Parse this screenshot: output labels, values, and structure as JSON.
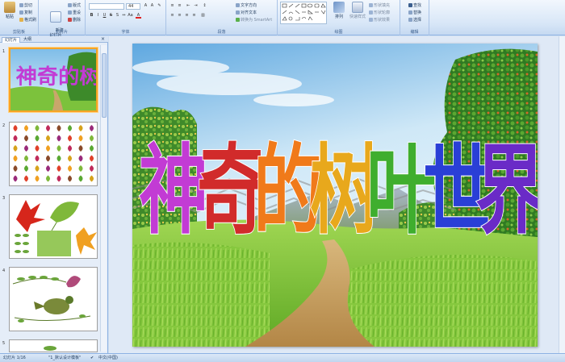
{
  "ribbon": {
    "clipboard": {
      "label": "剪贴板",
      "paste": "粘贴",
      "cut": "剪切",
      "copy": "复制",
      "format_painter": "格式刷"
    },
    "slides": {
      "label": "幻灯片",
      "new_slide": "新建\n幻灯片",
      "layout": "版式",
      "reset": "重设",
      "delete": "删除"
    },
    "font": {
      "label": "字体",
      "font_name": "",
      "font_size": "44"
    },
    "paragraph": {
      "label": "段落",
      "text_direction": "文字方向",
      "align_text": "对齐文本",
      "smartart": "转换为 SmartArt"
    },
    "drawing": {
      "label": "绘图",
      "arrange": "排列",
      "quick_styles": "快速样式",
      "shape_fill": "形状填充",
      "shape_outline": "形状轮廓",
      "shape_effects": "形状效果"
    },
    "editing": {
      "label": "编辑",
      "find": "查找",
      "replace": "替换",
      "select": "选择"
    }
  },
  "left_pane": {
    "tabs": [
      "幻灯片",
      "大纲"
    ],
    "slide_numbers": [
      "1",
      "2",
      "3",
      "4",
      "5"
    ]
  },
  "slide": {
    "title": "神奇的树叶世界",
    "title_chars": [
      "神",
      "奇",
      "的",
      "树",
      "叶",
      "世",
      "界"
    ],
    "title_colors": [
      "#c23bd4",
      "#d12b2b",
      "#f07a1a",
      "#e8a81c",
      "#3fae2e",
      "#2a3fd6",
      "#6a2bc7"
    ]
  },
  "status_bar": {
    "slide_count": "幻灯片 1/16",
    "theme": "\"1_默认设计模板\"",
    "language": "中文(中国)"
  }
}
